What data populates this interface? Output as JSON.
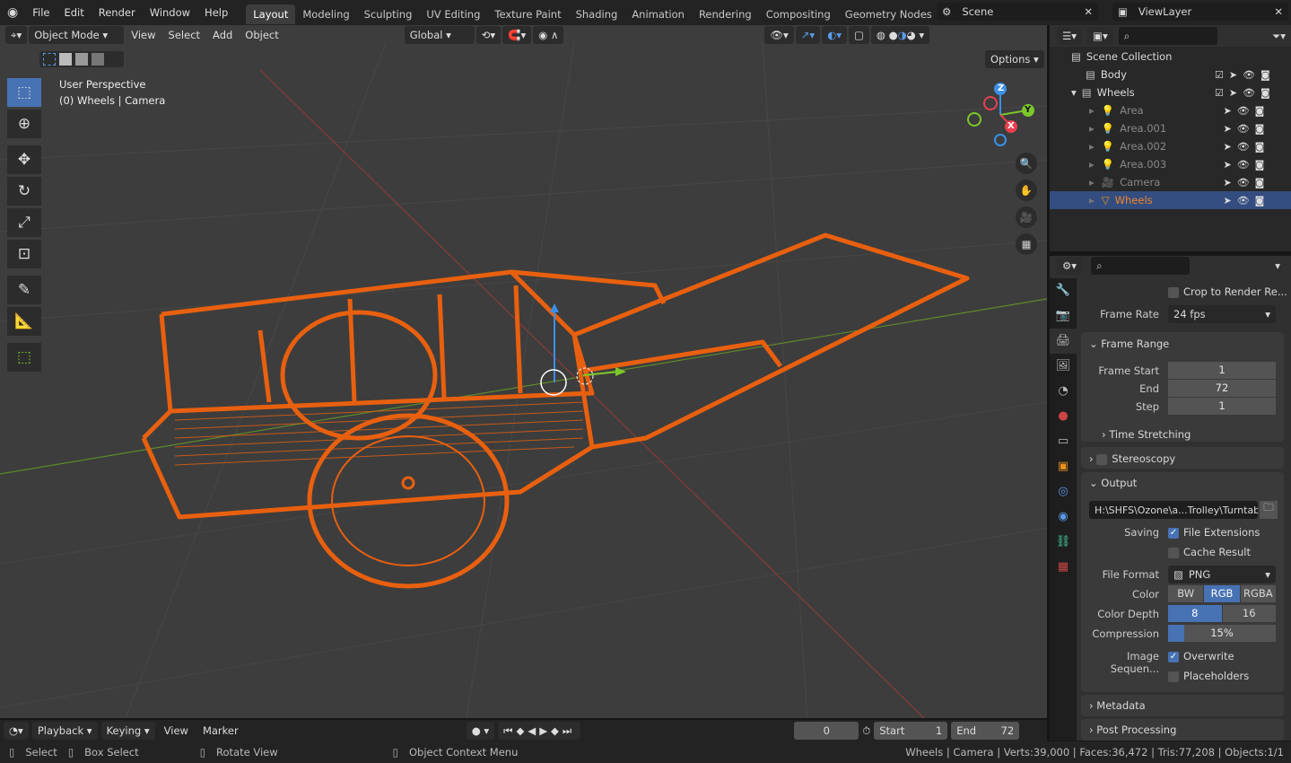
{
  "topbar": {
    "menus": [
      "File",
      "Edit",
      "Render",
      "Window",
      "Help"
    ],
    "workspaces": [
      "Layout",
      "Modeling",
      "Sculpting",
      "UV Editing",
      "Texture Paint",
      "Shading",
      "Animation",
      "Rendering",
      "Compositing",
      "Geometry Nodes",
      "Scripting"
    ],
    "active_workspace": "Layout",
    "scene": "Scene",
    "view_layer": "ViewLayer"
  },
  "viewport": {
    "mode": "Object Mode",
    "menus": [
      "View",
      "Select",
      "Add",
      "Object"
    ],
    "orientation": "Global",
    "options": "Options",
    "overlay_title": "User Perspective",
    "overlay_sub": "(0) Wheels | Camera",
    "object_color": "#e8600f",
    "gizmo": {
      "z": "Z",
      "y": "Y",
      "x": "X"
    }
  },
  "outliner": {
    "root": "Scene Collection",
    "items": [
      {
        "name": "Body",
        "type": "collection"
      },
      {
        "name": "Wheels",
        "type": "collection"
      },
      {
        "name": "Area",
        "type": "light"
      },
      {
        "name": "Area.001",
        "type": "light"
      },
      {
        "name": "Area.002",
        "type": "light"
      },
      {
        "name": "Area.003",
        "type": "light"
      },
      {
        "name": "Camera",
        "type": "camera"
      },
      {
        "name": "Wheels",
        "type": "mesh",
        "selected": true
      }
    ]
  },
  "properties": {
    "crop": "Crop to Render Re...",
    "frame_rate_label": "Frame Rate",
    "frame_rate": "24 fps",
    "frame_range": {
      "title": "Frame Range",
      "start_label": "Frame Start",
      "start": "1",
      "end_label": "End",
      "end": "72",
      "step_label": "Step",
      "step": "1",
      "time_stretching": "Time Stretching"
    },
    "stereoscopy": "Stereoscopy",
    "output": {
      "title": "Output",
      "path": "H:\\SHFS\\Ozone\\a...Trolley\\Turntable\\",
      "saving_label": "Saving",
      "file_ext": "File Extensions",
      "cache": "Cache Result",
      "format_label": "File Format",
      "format": "PNG",
      "color_label": "Color",
      "color_opts": [
        "BW",
        "RGB",
        "RGBA"
      ],
      "color_active": "RGB",
      "depth_label": "Color Depth",
      "depth_opts": [
        "8",
        "16"
      ],
      "depth_active": "8",
      "compression_label": "Compression",
      "compression": "15%",
      "compression_value": 15,
      "image_seq_label": "Image Sequen...",
      "overwrite": "Overwrite",
      "placeholders": "Placeholders"
    },
    "metadata": "Metadata",
    "post_processing": "Post Processing"
  },
  "timeline": {
    "menus": [
      "Playback",
      "Keying",
      "View",
      "Marker"
    ],
    "current_frame": "0",
    "start_label": "Start",
    "start": "1",
    "end_label": "End",
    "end": "72"
  },
  "status": {
    "select": "Select",
    "box_select": "Box Select",
    "rotate": "Rotate View",
    "context": "Object Context Menu",
    "stats": "Wheels | Camera | Verts:39,000 | Faces:36,472 | Tris:77,208 | Objects:1/1"
  }
}
